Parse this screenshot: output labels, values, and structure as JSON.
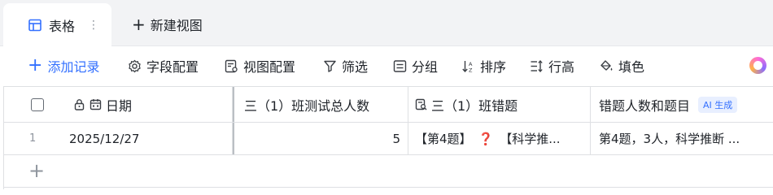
{
  "tabs": {
    "active": {
      "label": "表格",
      "more": "⋮"
    },
    "new_view": {
      "label": "新建视图",
      "icon": "plus-icon"
    }
  },
  "toolbar": {
    "add_record": "添加记录",
    "field_config": "字段配置",
    "view_config": "视图配置",
    "filter": "筛选",
    "group": "分组",
    "sort": "排序",
    "row_height": "行高",
    "fill_color": "填色",
    "accent_color": "#3370ff"
  },
  "table": {
    "columns": [
      {
        "label": "日期",
        "icons": [
          "lock-icon",
          "calendar-icon"
        ]
      },
      {
        "label": "三（1）班测试总人数"
      },
      {
        "label": "三（1）班错题",
        "icon": "lookup-icon"
      },
      {
        "label": "错题人数和题目",
        "badge": "AI 生成"
      }
    ],
    "rows": [
      {
        "index": "1",
        "date": "2025/12/27",
        "total": "5",
        "wrong_part1": "【第4题】",
        "wrong_mark": "❓",
        "wrong_part2": "【科学推...",
        "ai_summary": "第4题，3人，科学推断 ..."
      }
    ]
  }
}
